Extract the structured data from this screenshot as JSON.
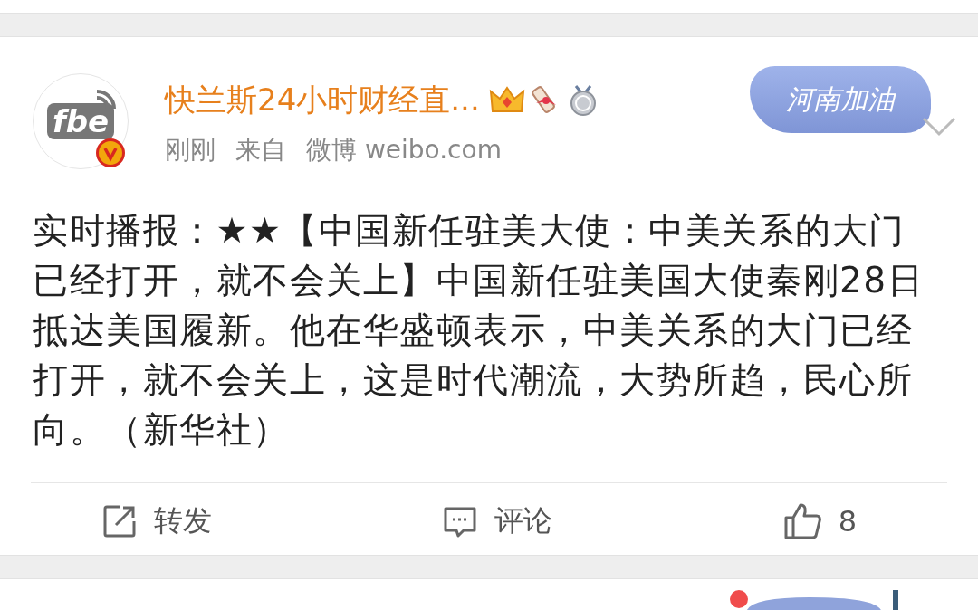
{
  "post": {
    "author": {
      "name": "快兰斯24小时财经直...",
      "avatar_text": "fbe",
      "verified": true
    },
    "time": "刚刚",
    "source_prefix": "来自",
    "source": "微博 weibo.com",
    "sticker": {
      "text": "河南加油"
    },
    "body": "实时播报：★★【中国新任驻美大使：中美关系的大门已经打开，就不会关上】中国新任驻美国大使秦刚28日抵达美国履新。他在华盛顿表示，中美关系的大门已经打开，就不会关上，这是时代潮流，大势所趋，民心所向。（新华社）",
    "actions": [
      {
        "kind": "repost",
        "label": "转发"
      },
      {
        "kind": "comment",
        "label": "评论"
      },
      {
        "kind": "like",
        "label": "8"
      }
    ]
  }
}
